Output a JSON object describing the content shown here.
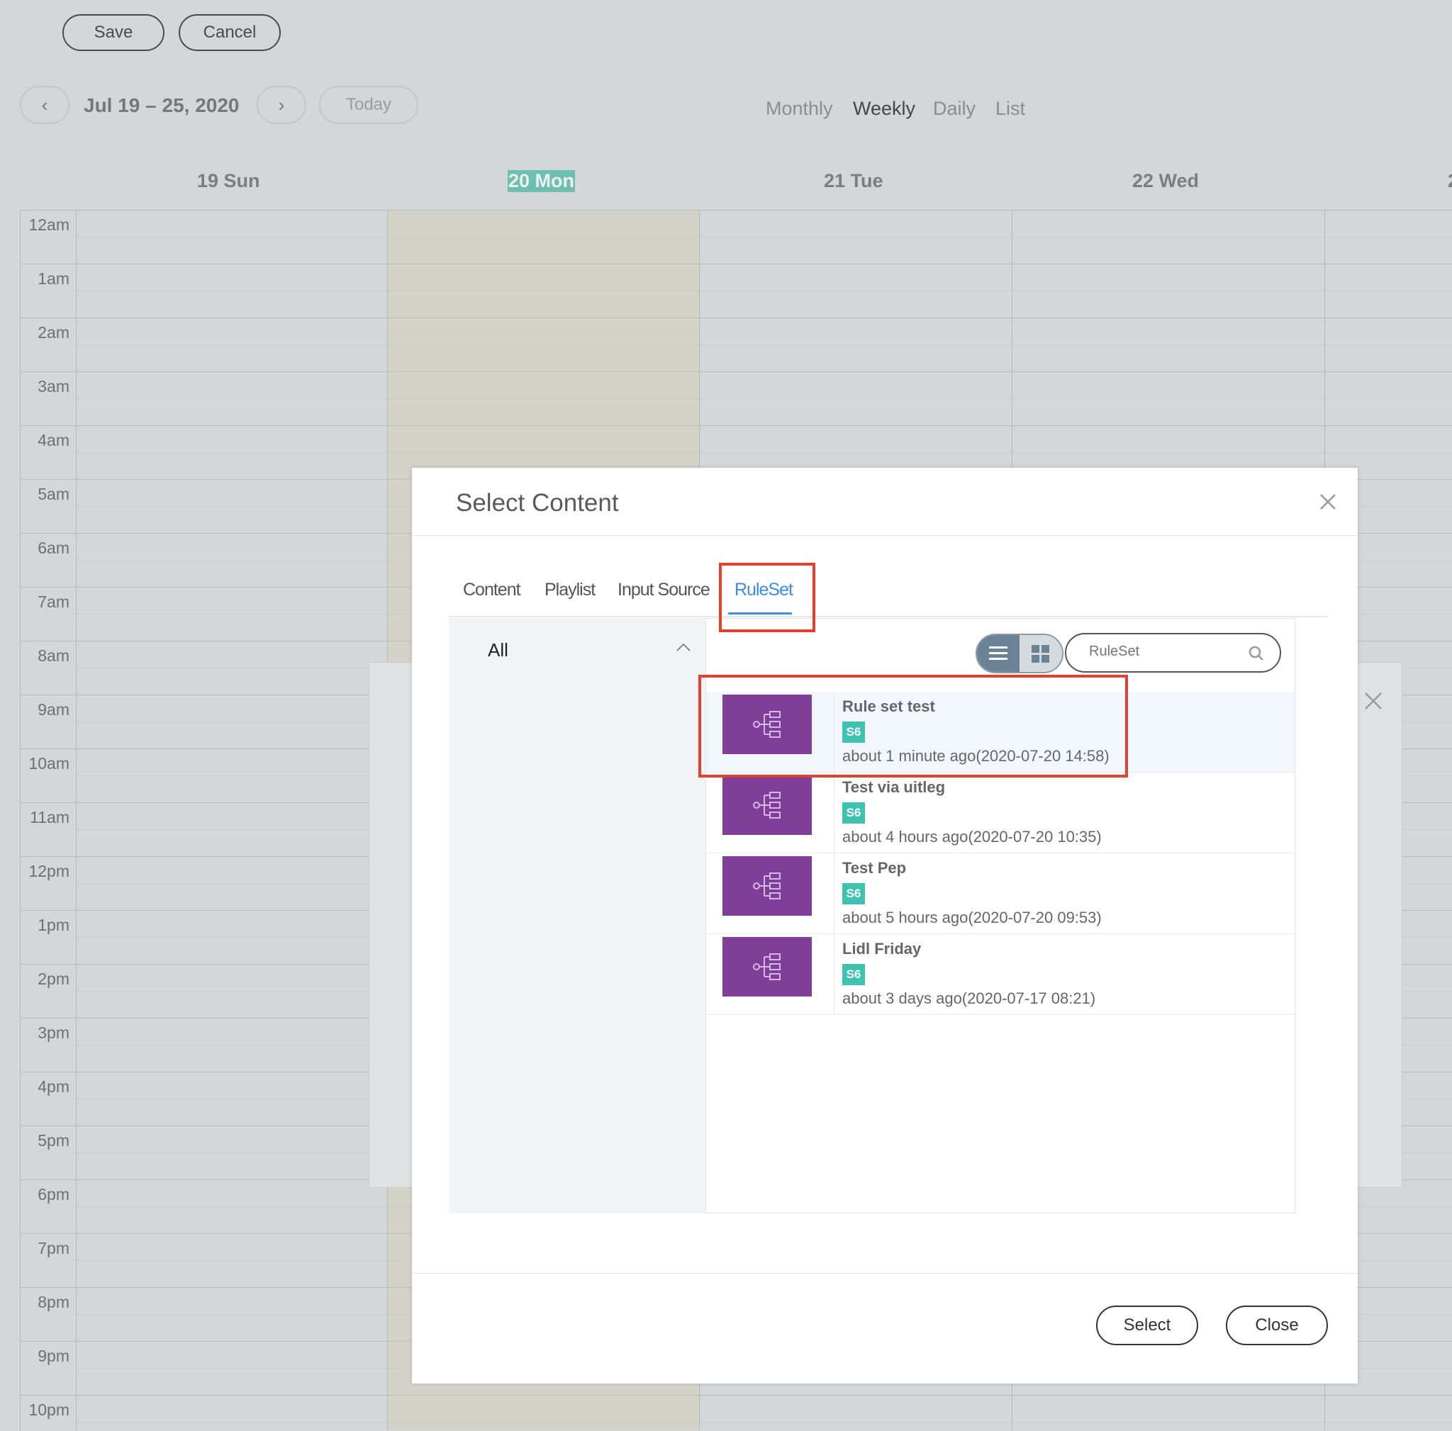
{
  "toolbar": {
    "save_label": "Save",
    "cancel_label": "Cancel"
  },
  "calendar": {
    "range": "Jul 19 – 25, 2020",
    "prev": "‹",
    "next": "›",
    "today": "Today",
    "views": [
      "Monthly",
      "Weekly",
      "Daily",
      "List"
    ],
    "active_view": "Weekly",
    "days": [
      "19 Sun",
      "20 Mon",
      "21 Tue",
      "22 Wed"
    ],
    "today_day": "20 Mon",
    "hours": [
      "12am",
      "1am",
      "2am",
      "3am",
      "4am",
      "5am",
      "6am",
      "7am",
      "8am",
      "9am",
      "10am",
      "11am",
      "12pm",
      "1pm",
      "2pm",
      "3pm",
      "4pm",
      "5pm",
      "6pm",
      "7pm",
      "8pm",
      "9pm",
      "10pm"
    ]
  },
  "modal": {
    "title": "Select Content",
    "tabs": [
      "Content",
      "Playlist",
      "Input Source",
      "RuleSet"
    ],
    "active_tab": "RuleSet",
    "category": "All",
    "search_placeholder": "RuleSet",
    "items": [
      {
        "name": "Rule set test",
        "badge": "S6",
        "meta": "about 1 minute ago(2020-07-20 14:58)",
        "selected": true
      },
      {
        "name": "Test via uitleg",
        "badge": "S6",
        "meta": "about 4 hours ago(2020-07-20 10:35)",
        "selected": false
      },
      {
        "name": "Test Pep",
        "badge": "S6",
        "meta": "about 5 hours ago(2020-07-20 09:53)",
        "selected": false
      },
      {
        "name": "Lidl Friday",
        "badge": "S6",
        "meta": "about 3 days ago(2020-07-17 08:21)",
        "selected": false
      }
    ],
    "select_label": "Select",
    "close_label": "Close"
  },
  "colors": {
    "accent": "#3b8fe0",
    "highlight": "#e3412f",
    "thumb": "#7f3f99",
    "badge": "#3fc3b0",
    "today": "#6fbfb0"
  }
}
